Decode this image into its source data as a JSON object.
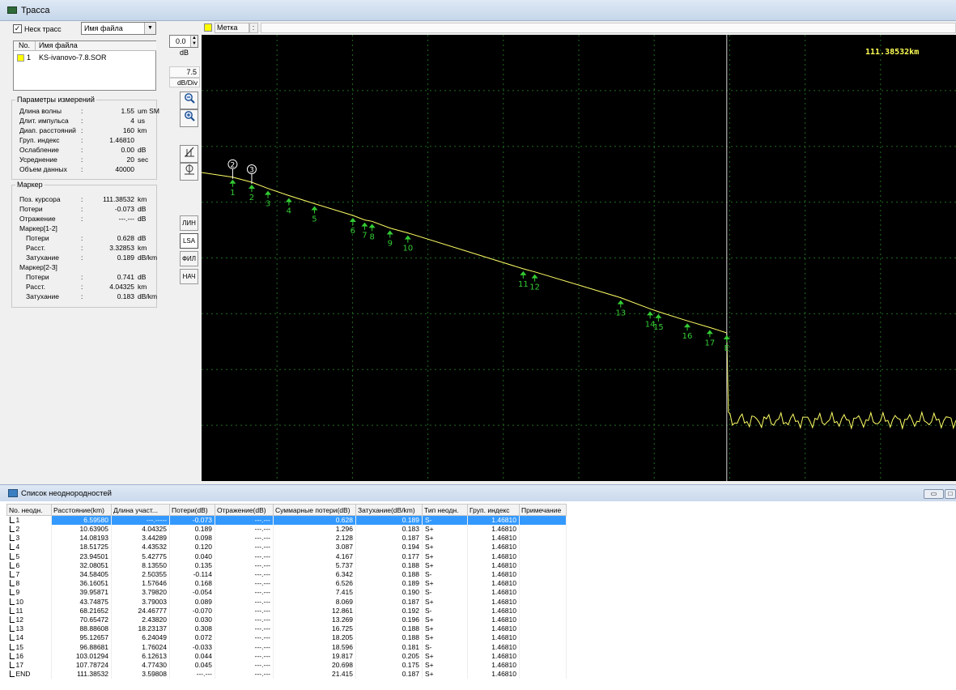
{
  "window_title": "Трасса",
  "left": {
    "multi_trace_label": "Неск трасс",
    "multi_trace_checked": true,
    "file_combo_value": "Имя файла",
    "file_list": {
      "col_no": "No.",
      "col_name": "Имя файла",
      "rows": [
        {
          "no": "1",
          "name": "KS-ivanovo-7.8.SOR"
        }
      ]
    },
    "params": {
      "title": "Параметры измерений",
      "rows": [
        {
          "name": "Длина волны",
          "value": "1.55",
          "unit": "um SM"
        },
        {
          "name": "Длит. импульса",
          "value": "4",
          "unit": "us"
        },
        {
          "name": "Диап. расстояний",
          "value": "160",
          "unit": "km"
        },
        {
          "name": "Груп. индекс",
          "value": "1.46810",
          "unit": ""
        },
        {
          "name": "Ослабление",
          "value": "0.00",
          "unit": "dB"
        },
        {
          "name": "Усреднение",
          "value": "20",
          "unit": "sec"
        },
        {
          "name": "Объем данных",
          "value": "40000",
          "unit": ""
        }
      ]
    },
    "marker": {
      "title": "Маркер",
      "rows": [
        {
          "name": "Поз. курсора",
          "value": "111.38532",
          "unit": "km",
          "indent": false
        },
        {
          "name": "Потери",
          "value": "-0.073",
          "unit": "dB",
          "indent": false
        },
        {
          "name": "Отражение",
          "value": "---.---",
          "unit": "dB",
          "indent": false
        },
        {
          "name": "Маркер[1-2]",
          "value": "",
          "unit": "",
          "indent": false
        },
        {
          "name": "Потери",
          "value": "0.628",
          "unit": "dB",
          "indent": true
        },
        {
          "name": "Расст.",
          "value": "3.32853",
          "unit": "km",
          "indent": true
        },
        {
          "name": "Затухание",
          "value": "0.189",
          "unit": "dB/km",
          "indent": true
        },
        {
          "name": "Маркер[2-3]",
          "value": "",
          "unit": "",
          "indent": false
        },
        {
          "name": "Потери",
          "value": "0.741",
          "unit": "dB",
          "indent": true
        },
        {
          "name": "Расст.",
          "value": "4.04325",
          "unit": "km",
          "indent": true
        },
        {
          "name": "Затухание",
          "value": "0.183",
          "unit": "dB/km",
          "indent": true
        }
      ]
    }
  },
  "toolbar": {
    "offset_value": "0.0",
    "offset_unit": "dB",
    "scale_value": "7.5",
    "scale_unit": "dB/Div",
    "zoom_out_icon": "zoom-out-icon",
    "zoom_in_icon": "zoom-in-icon",
    "modes": [
      "ЛИН",
      "LSA",
      "ФИЛ",
      "НАЧ"
    ],
    "selected_mode": "LSA"
  },
  "graph": {
    "label_tab": "Метка",
    "label_sep": ":",
    "cursor_readout": "111.38532km",
    "cursor_km": 111.38532,
    "trace_color": "#ffff66",
    "event_color": "#33cc33",
    "grid_color": "#1f6b1f",
    "x_range_km": [
      0,
      160
    ],
    "markers": [
      "2",
      "3"
    ],
    "end_label": "E"
  },
  "list": {
    "title": "Список неоднородностей",
    "columns": [
      "No. неодн.",
      "Расстояние(km)",
      "Длина участ...",
      "Потери(dB)",
      "Отражение(dB)",
      "Суммарные потери(dB)",
      "Затухание(dB/km)",
      "Тип неодн.",
      "Груп. индекс",
      "Примечание"
    ],
    "rows": [
      [
        "1",
        "6.59580",
        "---.-----",
        "-0.073",
        "---.---",
        "0.628",
        "0.189",
        "S-",
        "1.46810",
        ""
      ],
      [
        "2",
        "10.63905",
        "4.04325",
        "0.189",
        "---.---",
        "1.296",
        "0.183",
        "S+",
        "1.46810",
        ""
      ],
      [
        "3",
        "14.08193",
        "3.44289",
        "0.098",
        "---.---",
        "2.128",
        "0.187",
        "S+",
        "1.46810",
        ""
      ],
      [
        "4",
        "18.51725",
        "4.43532",
        "0.120",
        "---.---",
        "3.087",
        "0.194",
        "S+",
        "1.46810",
        ""
      ],
      [
        "5",
        "23.94501",
        "5.42775",
        "0.040",
        "---.---",
        "4.167",
        "0.177",
        "S+",
        "1.46810",
        ""
      ],
      [
        "6",
        "32.08051",
        "8.13550",
        "0.135",
        "---.---",
        "5.737",
        "0.188",
        "S+",
        "1.46810",
        ""
      ],
      [
        "7",
        "34.58405",
        "2.50355",
        "-0.114",
        "---.---",
        "6.342",
        "0.188",
        "S-",
        "1.46810",
        ""
      ],
      [
        "8",
        "36.16051",
        "1.57646",
        "0.168",
        "---.---",
        "6.526",
        "0.189",
        "S+",
        "1.46810",
        ""
      ],
      [
        "9",
        "39.95871",
        "3.79820",
        "-0.054",
        "---.---",
        "7.415",
        "0.190",
        "S-",
        "1.46810",
        ""
      ],
      [
        "10",
        "43.74875",
        "3.79003",
        "0.089",
        "---.---",
        "8.069",
        "0.187",
        "S+",
        "1.46810",
        ""
      ],
      [
        "11",
        "68.21652",
        "24.46777",
        "-0.070",
        "---.---",
        "12.861",
        "0.192",
        "S-",
        "1.46810",
        ""
      ],
      [
        "12",
        "70.65472",
        "2.43820",
        "0.030",
        "---.---",
        "13.269",
        "0.196",
        "S+",
        "1.46810",
        ""
      ],
      [
        "13",
        "88.88608",
        "18.23137",
        "0.308",
        "---.---",
        "16.725",
        "0.188",
        "S+",
        "1.46810",
        ""
      ],
      [
        "14",
        "95.12657",
        "6.24049",
        "0.072",
        "---.---",
        "18.205",
        "0.188",
        "S+",
        "1.46810",
        ""
      ],
      [
        "15",
        "96.88681",
        "1.76024",
        "-0.033",
        "---.---",
        "18.596",
        "0.181",
        "S-",
        "1.46810",
        ""
      ],
      [
        "16",
        "103.01294",
        "6.12613",
        "0.044",
        "---.---",
        "19.817",
        "0.205",
        "S+",
        "1.46810",
        ""
      ],
      [
        "17",
        "107.78724",
        "4.77430",
        "0.045",
        "---.---",
        "20.698",
        "0.175",
        "S+",
        "1.46810",
        ""
      ],
      [
        "END",
        "111.38532",
        "3.59808",
        "---.---",
        "---.---",
        "21.415",
        "0.187",
        "S+",
        "1.46810",
        ""
      ]
    ],
    "selected_row": 0
  }
}
